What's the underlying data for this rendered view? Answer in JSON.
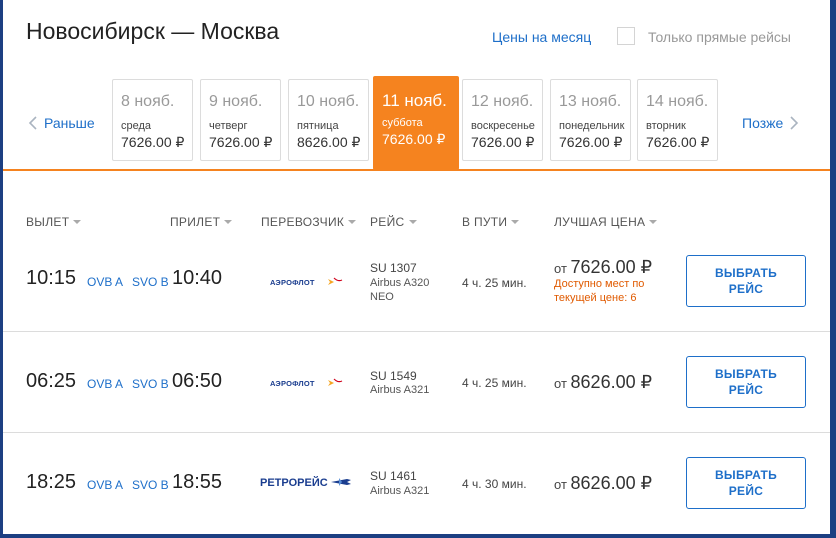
{
  "header": {
    "route": "Новосибирск — Москва",
    "month_prices_link": "Цены на месяц",
    "direct_only_label": "Только прямые рейсы"
  },
  "date_nav": {
    "prev_label": "Раньше",
    "next_label": "Позже",
    "dates": [
      {
        "date": "8 нояб.",
        "weekday": "среда",
        "price": "7626.00 ₽"
      },
      {
        "date": "9 нояб.",
        "weekday": "четверг",
        "price": "7626.00 ₽"
      },
      {
        "date": "10 нояб.",
        "weekday": "пятница",
        "price": "8626.00 ₽"
      },
      {
        "date": "11 нояб.",
        "weekday": "суббота",
        "price": "7626.00 ₽",
        "active": true
      },
      {
        "date": "12 нояб.",
        "weekday": "воскресенье",
        "price": "7626.00 ₽"
      },
      {
        "date": "13 нояб.",
        "weekday": "понедельник",
        "price": "7626.00 ₽"
      },
      {
        "date": "14 нояб.",
        "weekday": "вторник",
        "price": "7626.00 ₽"
      }
    ]
  },
  "columns": {
    "depart": "ВЫЛЕТ",
    "arrive": "ПРИЛЕТ",
    "carrier": "ПЕРЕВОЗЧИК",
    "flight": "РЕЙС",
    "duration": "В ПУТИ",
    "best_price": "ЛУЧШАЯ ЦЕНА"
  },
  "flights": [
    {
      "dep_time": "10:15",
      "dep_airport": "OVB A",
      "arr_airport": "SVO B",
      "arr_time": "10:40",
      "carrier": "АЭРОФЛОТ",
      "carrier_logo": "aeroflot-logo",
      "flight_no": "SU 1307",
      "aircraft_line1": "Airbus A320",
      "aircraft_line2": "NEO",
      "duration": "4 ч. 25 мин.",
      "price_prefix": "от",
      "price": "7626.00 ₽",
      "seats_line1": "Доступно мест по",
      "seats_line2": "текущей цене: 6",
      "button_line1": "ВЫБРАТЬ",
      "button_line2": "РЕЙС"
    },
    {
      "dep_time": "06:25",
      "dep_airport": "OVB A",
      "arr_airport": "SVO B",
      "arr_time": "06:50",
      "carrier": "АЭРОФЛОТ",
      "carrier_logo": "aeroflot-logo",
      "flight_no": "SU 1549",
      "aircraft_line1": "Airbus A321",
      "aircraft_line2": "",
      "duration": "4 ч. 25 мин.",
      "price_prefix": "от",
      "price": "8626.00 ₽",
      "seats_line1": "",
      "seats_line2": "",
      "button_line1": "ВЫБРАТЬ",
      "button_line2": "РЕЙС"
    },
    {
      "dep_time": "18:25",
      "dep_airport": "OVB A",
      "arr_airport": "SVO B",
      "arr_time": "18:55",
      "carrier": "РЕТРОРЕЙС",
      "carrier_logo": "retroreis-logo",
      "flight_no": "SU 1461",
      "aircraft_line1": "Airbus A321",
      "aircraft_line2": "",
      "duration": "4 ч. 30 мин.",
      "price_prefix": "от",
      "price": "8626.00 ₽",
      "seats_line1": "",
      "seats_line2": "",
      "button_line1": "ВЫБРАТЬ",
      "button_line2": "РЕЙС"
    }
  ],
  "colors": {
    "accent_orange": "#f5831f",
    "link_blue": "#1e6fc9",
    "frame_navy": "#1c3f82",
    "aeroflot_red": "#d0021b",
    "aeroflot_blue": "#1a3d8f"
  }
}
